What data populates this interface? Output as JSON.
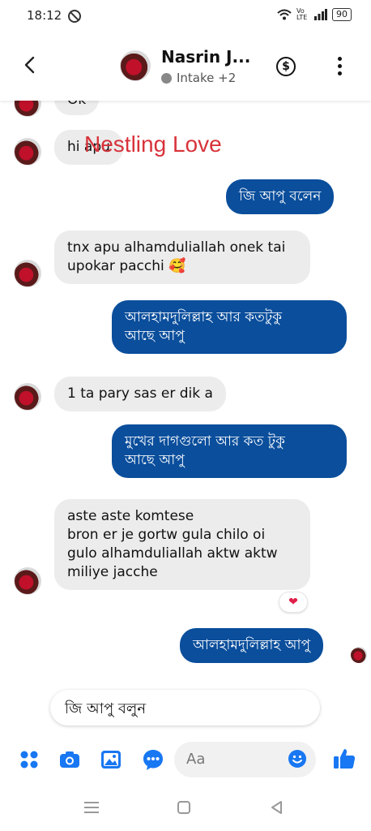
{
  "status_bar": {
    "time": "18:12",
    "network": "Vo LTE",
    "battery": "90"
  },
  "header": {
    "name": "Nasrin J...",
    "status": "Intake +2"
  },
  "watermark": "Nestling Love",
  "messages": [
    {
      "dir": "in",
      "text": "Ok"
    },
    {
      "dir": "in",
      "text": "hi apu"
    },
    {
      "dir": "out",
      "text": "জি আপু বলেন"
    },
    {
      "dir": "in",
      "line1": "tnx apu alhamduliallah onek tai",
      "line2": "upokar pacchi 🥰"
    },
    {
      "dir": "out",
      "line1": "আলহামদুলিল্লাহ আর কতটুকু",
      "line2": "আছে আপু"
    },
    {
      "dir": "in",
      "text": "1 ta pary sas er dik a"
    },
    {
      "dir": "out",
      "line1": "মুখের দাগগুলো আর কত টুকু",
      "line2": "আছে আপু"
    },
    {
      "dir": "in",
      "line1": "aste aste komtese",
      "line2": "bron er je gortw gula chilo oi",
      "line3": "gulo alhamduliallah aktw aktw",
      "line4": "miliye jacche"
    },
    {
      "dir": "out",
      "text": "আলহামদুলিল্লাহ আপু"
    }
  ],
  "reaction": "❤",
  "suggested_reply": "জি আপু বলুন",
  "composer": {
    "placeholder": "Aa"
  },
  "colors": {
    "outgoing": "#0a4e9c",
    "incoming": "#ececec",
    "accent": "#1877f2",
    "watermark": "#d8323a"
  },
  "icons": [
    "back-arrow-icon",
    "dollar-icon",
    "more-icon",
    "apps-icon",
    "camera-icon",
    "gallery-icon",
    "messenger-chat-icon",
    "emoji-icon",
    "thumbs-up-icon"
  ]
}
